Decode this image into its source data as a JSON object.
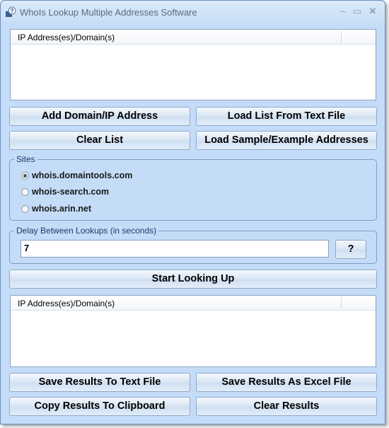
{
  "window": {
    "title": "WhoIs Lookup Multiple Addresses Software",
    "controls": {
      "minimize": "–",
      "maximize": "▭",
      "close": "✕"
    }
  },
  "input_list": {
    "column_header": "IP Address(es)/Domain(s)",
    "rows": []
  },
  "buttons": {
    "add_domain": "Add Domain/IP Address",
    "load_list": "Load List From Text File",
    "clear_list": "Clear List",
    "load_sample": "Load Sample/Example Addresses",
    "help": "?",
    "start": "Start Looking Up",
    "save_text": "Save Results To Text File",
    "save_excel": "Save Results As Excel File",
    "copy_clipboard": "Copy Results To Clipboard",
    "clear_results": "Clear Results"
  },
  "sites": {
    "label": "Sites",
    "options": [
      {
        "label": "whois.domaintools.com",
        "selected": true
      },
      {
        "label": "whois-search.com",
        "selected": false
      },
      {
        "label": "whois.arin.net",
        "selected": false
      }
    ]
  },
  "delay": {
    "label": "Delay Between Lookups (in seconds)",
    "value": "7"
  },
  "results_list": {
    "column_header": "IP Address(es)/Domain(s)",
    "rows": []
  }
}
